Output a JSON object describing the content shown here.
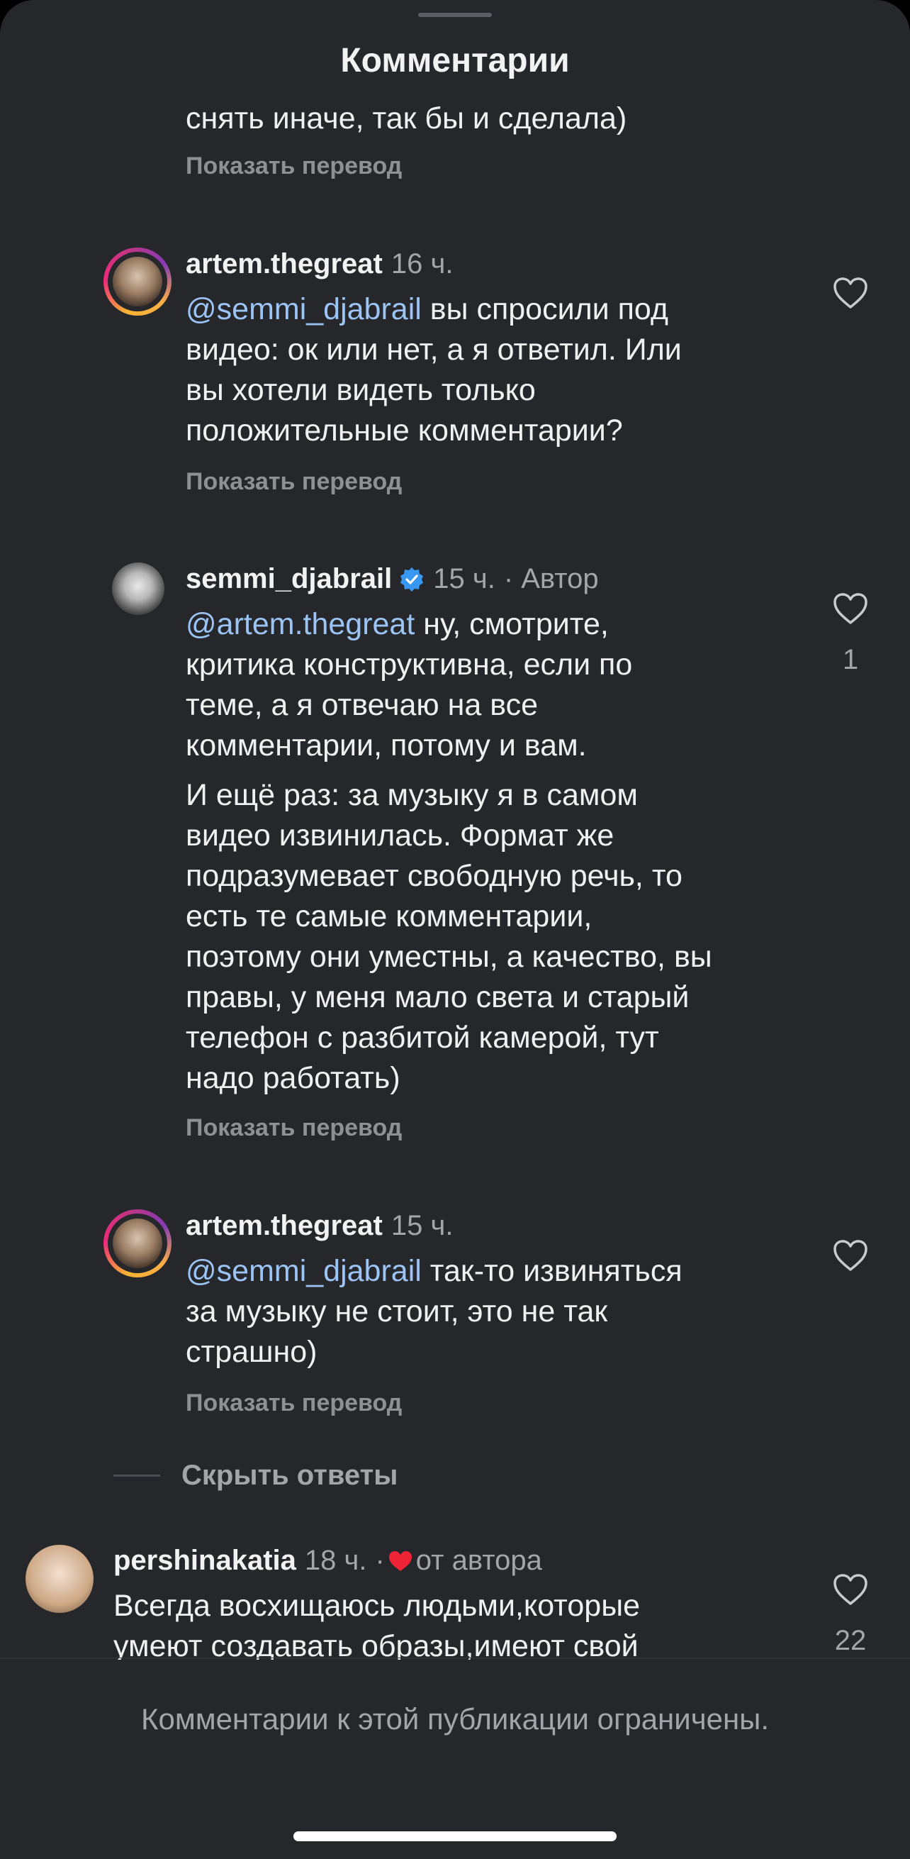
{
  "sheet": {
    "title": "Комментарии"
  },
  "partial_comment": {
    "text": "снять иначе, так бы и сделала)",
    "translate": "Показать перевод"
  },
  "comments": [
    {
      "username": "artem.thegreat",
      "time": "16 ч.",
      "mention": "@semmi_djabrail",
      "lines": [
        " вы спросили под",
        "видео: ок или нет, а я ответил. Или",
        "вы хотели видеть только",
        "положительные комментарии?"
      ],
      "translate": "Показать перевод"
    },
    {
      "username": "semmi_djabrail",
      "time": "15 ч.",
      "author_label": "· Автор",
      "mention": "@artem.thegreat",
      "lines": [
        " ну, смотрите,",
        "критика конструктивна, если по",
        "теме, а я отвечаю на все",
        "комментарии, потому и вам."
      ],
      "paragraph2": [
        "И ещё раз: за музыку я в самом",
        "видео извинилась. Формат же",
        "подразумевает свободную речь, то",
        "есть те самые комментарии,",
        "поэтому они уместны, а качество, вы",
        "правы, у меня мало света и старый",
        "телефон с разбитой камерой, тут",
        "надо работать)"
      ],
      "likes": "1",
      "translate": "Показать перевод"
    },
    {
      "username": "artem.thegreat",
      "time": "15 ч.",
      "mention": "@semmi_djabrail",
      "lines": [
        " так-то извиняться",
        "за музыку не стоит, это не так",
        "страшно)"
      ],
      "translate": "Показать перевод"
    },
    {
      "username": "pershinakatia",
      "time": "18 ч.",
      "dot": "·",
      "author_like": "от автора",
      "lines": [
        "Всегда восхищаюсь людьми,которые",
        "умеют создавать образы,имеют свой"
      ],
      "likes": "22"
    }
  ],
  "hide_replies": "Скрыть ответы",
  "footer": "Комментарии к этой публикации ограничены.",
  "colors": {
    "background": "#25272b",
    "mention": "#9bc4f5",
    "heart_red": "#ee2436",
    "verified": "#3897f0"
  }
}
